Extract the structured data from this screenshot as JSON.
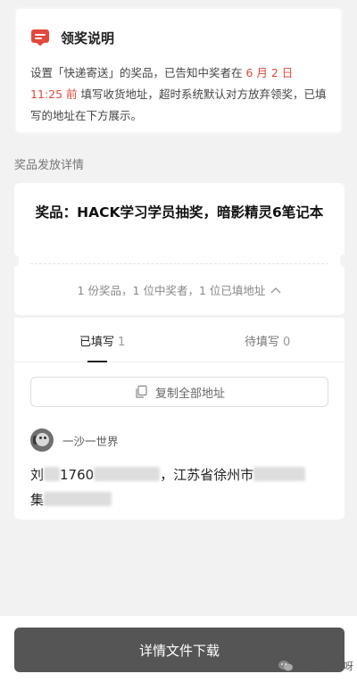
{
  "notice": {
    "title": "领奖说明",
    "text_part1": "设置「快递寄送」的奖品，已告知中奖者在 ",
    "deadline_date": "6 月 2 日",
    "deadline_time": "11:25 前",
    "text_part2": " 填写收货地址，超时系统默认对方放弃领奖，已填写的地址在下方展示。",
    "highlight_color": "#e2483b",
    "icon": "message-box-icon"
  },
  "section_label": "奖品发放详情",
  "prize": {
    "title": "奖品：HACK学习学员抽奖，暗影精灵6笔记本",
    "stats": "1 份奖品，1 位中奖者，1 位已填地址",
    "toggle_icon": "chevron-up-icon"
  },
  "tabs": [
    {
      "label": "已填写",
      "count": "1"
    },
    {
      "label": "待填写",
      "count": "0"
    }
  ],
  "copy_button": {
    "label": "复制全部地址",
    "icon": "copy-icon"
  },
  "winner": {
    "name": "一沙一世界",
    "address_visible_1": "刘",
    "address_visible_2": "1760",
    "address_visible_3": "，江苏省徐州市",
    "address_visible_4": "集"
  },
  "download_button": {
    "label": "详情文件下载"
  },
  "watermark": {
    "text": "HACK学习呀",
    "icon": "wechat-icon"
  }
}
